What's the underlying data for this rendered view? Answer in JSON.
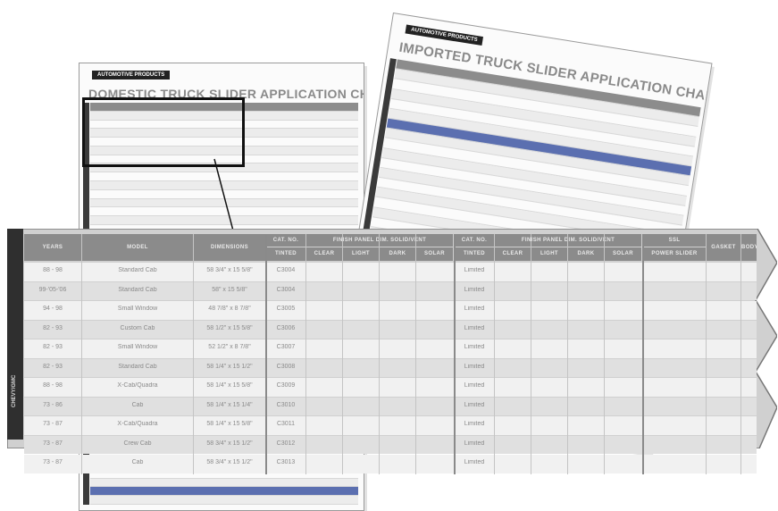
{
  "domestic_sheet": {
    "brand": "AUTOMOTIVE PRODUCTS",
    "title": "DOMESTIC TRUCK SLIDER APPLICATION CHART"
  },
  "imported_sheet": {
    "brand": "AUTOMOTIVE PRODUCTS",
    "title": "IMPORTED TRUCK SLIDER APPLICATION CHART"
  },
  "zoom_table": {
    "side_label": "CHEVY/GMC",
    "columns": {
      "years": "YEARS",
      "model": "MODEL",
      "dimensions": "DIMENSIONS",
      "cat1": "CAT. NO.",
      "cat1_sub": "TINTED",
      "finish1": "FINISH PANEL DIM. SOLID/VENT",
      "finish1_subs": [
        "CLEAR",
        "LIGHT",
        "DARK",
        "SOLAR"
      ],
      "cat2": "CAT. NO.",
      "cat2_sub": "TINTED",
      "finish2": "FINISH PANEL DIM. SOLID/VENT",
      "finish2_subs": [
        "CLEAR",
        "LIGHT",
        "DARK",
        "SOLAR"
      ],
      "sl1": "SSL",
      "sl1_sub": "POWER SLIDER",
      "gasket": "GASKET",
      "body": "BODY"
    },
    "rows": [
      {
        "years": "88 - 98",
        "model": "Standard Cab",
        "dims": "58 3/4\" x 15 5/8\"",
        "cat": "C3004",
        "status": "Limited"
      },
      {
        "years": "99-'05-'06",
        "model": "Standard Cab",
        "dims": "58\" x 15 5/8\"",
        "cat": "C3004",
        "status": "Limited"
      },
      {
        "years": "94 - 98",
        "model": "Small Window",
        "dims": "48 7/8\" x 8 7/8\"",
        "cat": "C3005",
        "status": "Limited"
      },
      {
        "years": "82 - 93",
        "model": "Custom Cab",
        "dims": "58 1/2\" x 15 5/8\"",
        "cat": "C3006",
        "status": "Limited"
      },
      {
        "years": "82 - 93",
        "model": "Small Window",
        "dims": "52 1/2\" x 8 7/8\"",
        "cat": "C3007",
        "status": "Limited"
      },
      {
        "years": "82 - 93",
        "model": "Standard Cab",
        "dims": "58 1/4\" x 15 1/2\"",
        "cat": "C3008",
        "status": "Limited"
      },
      {
        "years": "88 - 98",
        "model": "X-Cab/Quadra",
        "dims": "58 1/4\" x 15 5/8\"",
        "cat": "C3009",
        "status": "Limited"
      },
      {
        "years": "73 - 86",
        "model": "Cab",
        "dims": "58 1/4\" x 15 1/4\"",
        "cat": "C3010",
        "status": "Limited"
      },
      {
        "years": "73 - 87",
        "model": "X-Cab/Quadra",
        "dims": "58 1/4\" x 15 5/8\"",
        "cat": "C3011",
        "status": "Limited"
      },
      {
        "years": "73 - 87",
        "model": "Crew Cab",
        "dims": "58 3/4\" x 15 1/2\"",
        "cat": "C3012",
        "status": "Limited"
      },
      {
        "years": "73 - 87",
        "model": "Cab",
        "dims": "58 3/4\" x 15 1/2\"",
        "cat": "C3013",
        "status": "Limited"
      }
    ]
  }
}
